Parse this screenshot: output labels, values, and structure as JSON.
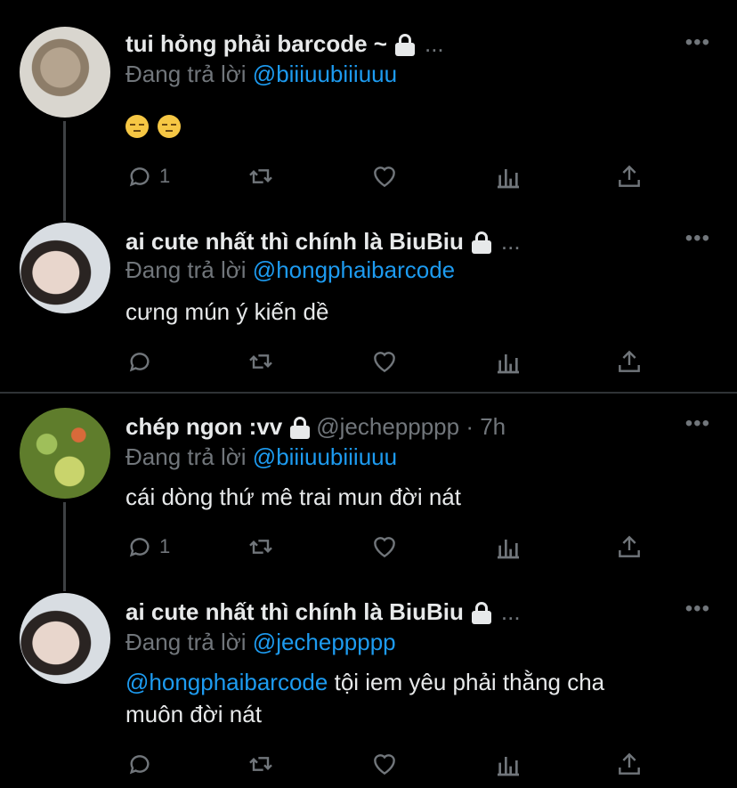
{
  "tweets": [
    {
      "name": "tui hỏng phải barcode ~",
      "handle": "",
      "truncation": "...",
      "more": "•••",
      "reply_prefix": "Đang trả lời",
      "reply_to": "@biiiuubiiiuuu",
      "body_emojis": [
        "unamused-face",
        "unamused-face"
      ],
      "reply_count": "1",
      "avatar": "cat"
    },
    {
      "name": "ai cute nhất thì chính là BiuBiu",
      "handle": "",
      "truncation": "...",
      "more": "•••",
      "reply_prefix": "Đang trả lời",
      "reply_to": "@hongphaibarcode",
      "body": "cưng mún ý kiến dề",
      "reply_count": "",
      "avatar": "person"
    },
    {
      "name": "chép ngon :vv",
      "handle": "@jecheppppp · 7h",
      "truncation": "",
      "more": "•••",
      "reply_prefix": "Đang trả lời",
      "reply_to": "@biiiuubiiiuuu",
      "body": "cái dòng thứ mê trai mun đời nát",
      "reply_count": "1",
      "avatar": "plant"
    },
    {
      "name": "ai cute nhất thì chính là BiuBiu",
      "handle": "",
      "truncation": "...",
      "more": "•••",
      "reply_prefix": "Đang trả lời",
      "reply_to": "@jecheppppp",
      "body_mention": "@hongphaibarcode",
      "body": "tội iem yêu phải thằng cha",
      "body_line2": "muôn đời nát",
      "reply_count": "",
      "avatar": "person"
    }
  ],
  "icons": {
    "reply": "reply-icon",
    "retweet": "retweet-icon",
    "like": "heart-icon",
    "views": "analytics-icon",
    "share": "share-icon",
    "lock": "lock-icon"
  },
  "colors": {
    "background": "#000000",
    "text": "#e7e9ea",
    "muted": "#71767b",
    "link": "#1d9bf0"
  }
}
